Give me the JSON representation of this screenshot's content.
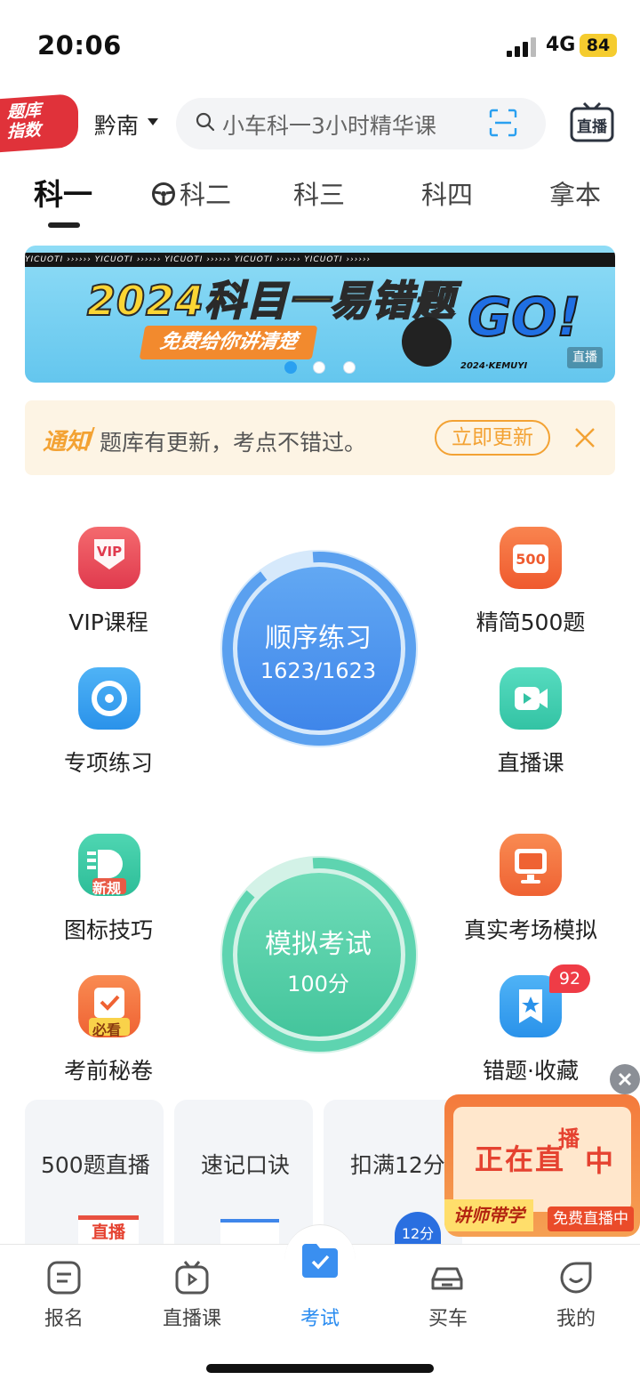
{
  "status_bar": {
    "time": "20:06",
    "network": "4G",
    "battery": "84"
  },
  "header": {
    "brand_line1": "题库",
    "brand_line2": "指数",
    "city": "黔南",
    "search_placeholder": "小车科一3小时精华课",
    "live_label": "直播"
  },
  "tabs": [
    {
      "label": "科一",
      "active": true
    },
    {
      "label": "科二",
      "icon": "steering-wheel-icon"
    },
    {
      "label": "科三"
    },
    {
      "label": "科四"
    },
    {
      "label": "拿本"
    }
  ],
  "banner": {
    "strip_text": "YICUOTI ›››››› YICUOTI ›››››› YICUOTI ›››››› YICUOTI ›››››› YICUOTI ››››››",
    "title": "2024科目一易错题",
    "subtitle": "免费给你讲清楚",
    "go": "GO!",
    "year_tag": "2024·KEMUYI",
    "corner_tag": "直播",
    "page_index": 1,
    "page_count": 3
  },
  "notice": {
    "tag": "通知",
    "slash": "/",
    "text": "题库有更新，考点不错过。",
    "button": "立即更新"
  },
  "functions": {
    "vip": {
      "label": "VIP课程",
      "icon": "vip-icon"
    },
    "jingjian": {
      "label": "精简500题",
      "icon": "500-icon",
      "icon_text": "500"
    },
    "zhuanxiang": {
      "label": "专项练习",
      "icon": "target-icon"
    },
    "zhibo": {
      "label": "直播课",
      "icon": "video-icon"
    },
    "tubiao": {
      "label": "图标技巧",
      "icon": "sign-icon",
      "icon_tag": "新规"
    },
    "zhenshi": {
      "label": "真实考场模拟",
      "icon": "monitor-icon"
    },
    "miquan": {
      "label": "考前秘卷",
      "icon": "clipboard-check-icon",
      "icon_tag": "必看"
    },
    "cuoti": {
      "label": "错题·收藏",
      "icon": "star-bookmark-icon",
      "badge": "92"
    },
    "practice": {
      "title": "顺序练习",
      "progress": "1623/1623",
      "done": 1623,
      "total": 1623
    },
    "exam": {
      "title": "模拟考试",
      "score": "100分"
    }
  },
  "cards": [
    {
      "title": "500题直播",
      "badge": "直播"
    },
    {
      "title": "速记口诀"
    },
    {
      "title": "扣满12分",
      "badge": "12分"
    }
  ],
  "live_float": {
    "text1": "正在直",
    "text2": "播",
    "text3": "中",
    "tag1": "讲师带学",
    "tag2": "免费直播中"
  },
  "tabbar": [
    {
      "label": "报名",
      "icon": "register-icon"
    },
    {
      "label": "直播课",
      "icon": "tv-icon"
    },
    {
      "label": "考试",
      "icon": "exam-check-icon",
      "active": true
    },
    {
      "label": "买车",
      "icon": "car-icon"
    },
    {
      "label": "我的",
      "icon": "profile-icon"
    }
  ],
  "colors": {
    "accent_blue": "#2aa0f0",
    "practice_blue": "#4a93ef",
    "exam_green": "#4fcfa6",
    "notice_orange": "#f3a233",
    "badge_red": "#ef3c46"
  }
}
